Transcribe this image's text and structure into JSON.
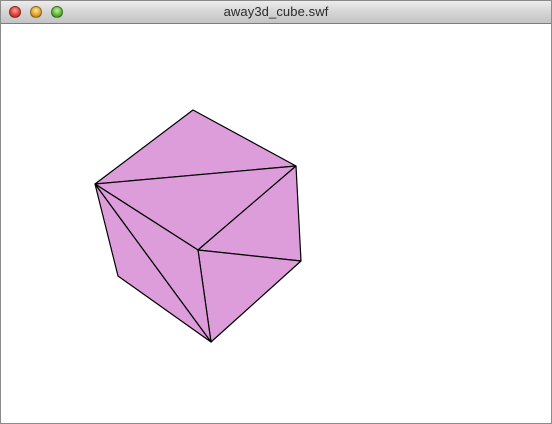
{
  "window": {
    "title": "away3d_cube.swf"
  },
  "controls": {
    "close_icon": "close-icon",
    "minimize_icon": "minimize-icon",
    "zoom_icon": "zoom-icon"
  },
  "colors": {
    "cube_face": "#dd9ddb",
    "edge": "#000000",
    "stage_background": "#ffffff"
  }
}
